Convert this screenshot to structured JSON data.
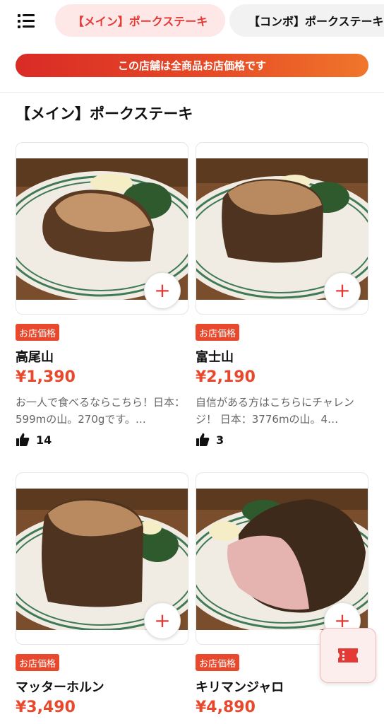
{
  "header": {
    "menu_icon": "list-menu-icon",
    "tabs": [
      {
        "label": "【メイン】ポークステーキ",
        "active": true
      },
      {
        "label": "【コンボ】ポークステーキ",
        "active": false
      }
    ]
  },
  "banner": {
    "text": "この店舗は全商品お店価格です"
  },
  "section": {
    "title": "【メイン】ポークステーキ"
  },
  "products": [
    {
      "badge": "お店価格",
      "name": "高尾山",
      "price": "¥1,390",
      "description": "お一人で食べるならこちら！日本：599mの山。270gです。…",
      "likes": "14"
    },
    {
      "badge": "お店価格",
      "name": "富士山",
      "price": "¥2,190",
      "description": "自信がある方はこちらにチャレンジ！ 日本：3776mの山。4…",
      "likes": "3"
    },
    {
      "badge": "お店価格",
      "name": "マッターホルン",
      "price": "¥3,490"
    },
    {
      "badge": "お店価格",
      "name": "キリマンジャロ",
      "price": "¥4,890"
    }
  ],
  "colors": {
    "accent": "#e53935",
    "badge": "#e8482c",
    "tab_active_bg": "#fde7e7"
  },
  "floating": {
    "icon": "ticket-icon"
  }
}
